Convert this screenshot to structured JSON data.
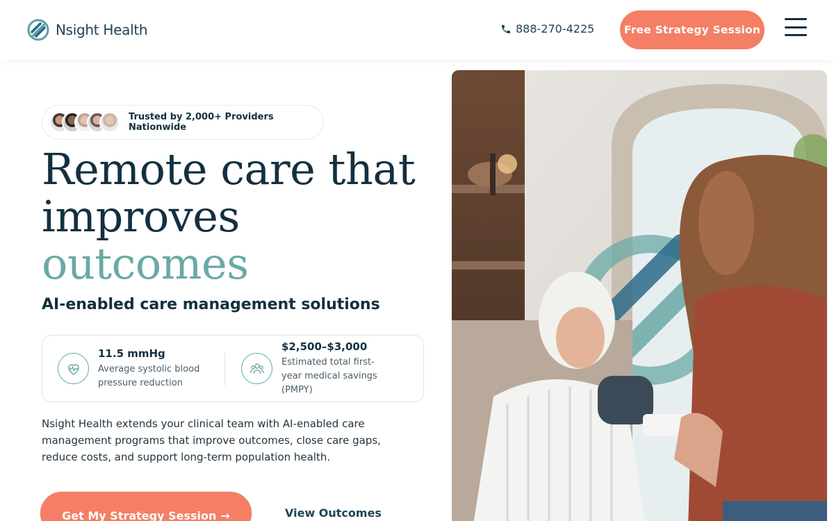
{
  "header": {
    "logo_text": "Nsight Health",
    "phone": "888-270-4225",
    "cta_label": "Free Strategy Session"
  },
  "hero": {
    "trusted_text": "Trusted by 2,000+ Providers Nationwide",
    "title_line1": "Remote care that",
    "title_line2": "improves",
    "title_line3": "outcomes",
    "subtitle": "AI-enabled care management solutions",
    "stats": [
      {
        "value": "11.5 mmHg",
        "label": "Average systolic blood pressure reduction",
        "icon": "heart-pulse-icon"
      },
      {
        "value": "$2,500–$3,000",
        "label": "Estimated total first-year medical savings (PMPY)",
        "icon": "people-icon"
      }
    ],
    "description": "Nsight Health extends your clinical team with AI-enabled care management programs that improve outcomes, close care gaps, reduce costs, and support long-term population health.",
    "primary_cta": "Get My Strategy Session",
    "secondary_cta": "View Outcomes"
  },
  "colors": {
    "accent": "#f47f64",
    "teal": "#6aa9a6",
    "navy": "#13303f"
  }
}
